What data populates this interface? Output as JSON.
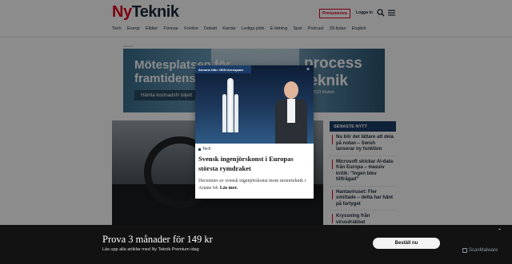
{
  "header": {
    "logo_ny": "Ny",
    "logo_teknik": "Teknik",
    "subscribe_label": "Prenumerera",
    "login_label": "Logga in",
    "search_icon": "search-icon",
    "menu_icon": "menu-icon"
  },
  "nav": [
    "Tech",
    "Energi",
    "Elbilar",
    "Försvar",
    "Fordon",
    "Debatt",
    "Karriär",
    "Lediga jobb",
    "E-tidning",
    "Spel",
    "Podcast",
    "33-listan",
    "English"
  ],
  "ad_banner": {
    "label": "ANNONS",
    "left_text": "Mötesplatsen för framtidens p",
    "right_text": "process teknik",
    "cta": "Hämta kostnadsfri biljett",
    "side_text": "ks 2023 Malmö"
  },
  "sidebar": {
    "title": "SENASTE NYTT",
    "items": [
      "Nu blir det lättare att dela på notan – Swish lanserar ny funktion",
      "Microsoft skickar AI-data från Europa – massiv kritik: ”Ingen blev tillfrågad”",
      "Hantaviruset: Fler smittade – detta har hänt på fartyget",
      "Kryssning från virusdrabbat"
    ]
  },
  "modal": {
    "label": "Annons från: GKN Aerospace",
    "close_icon": "close-icon",
    "category": "Tech",
    "headline": "Svensk ingenjörskonst i Europas största rymdraket",
    "body": "Decennier av svensk ingenjörskonst inom motorteknik i Ariane 64.",
    "read_more": "Läs mer."
  },
  "paywall": {
    "title": "Prova 3 månader för 149 kr",
    "subtitle": "Läs upp alla artiklar med Ny Teknik Premium idag",
    "button": "Beställ nu",
    "chevron_icon": "chevron-up-icon"
  },
  "watermark": "ScanMalware",
  "colors": {
    "brand_red": "#e2001a",
    "navy": "#1b3c67",
    "paywall_bg": "#121212"
  }
}
